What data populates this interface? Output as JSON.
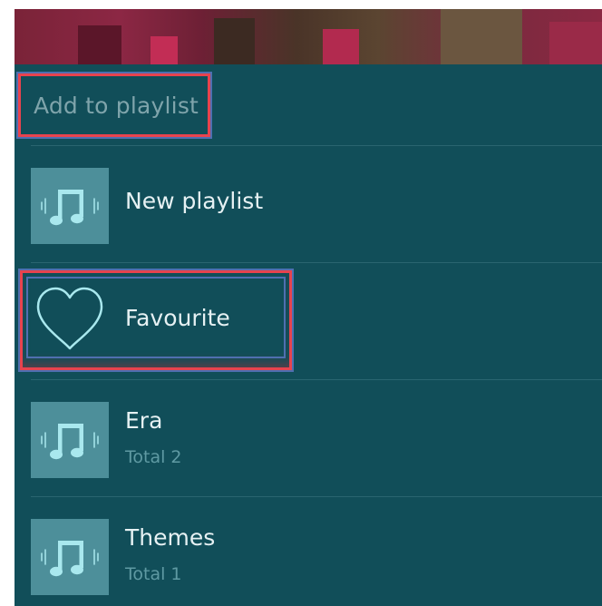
{
  "dialog": {
    "title": "Add to playlist"
  },
  "playlists": [
    {
      "label": "New playlist",
      "subtitle": "",
      "icon": "music-note-icon"
    },
    {
      "label": "Favourite",
      "subtitle": "",
      "icon": "heart-icon"
    },
    {
      "label": "Era",
      "subtitle": "Total 2",
      "icon": "music-note-icon"
    },
    {
      "label": "Themes",
      "subtitle": "Total 1",
      "icon": "music-note-icon"
    }
  ],
  "colors": {
    "background": "#114e59",
    "thumb": "#4d8f9a",
    "highlight_border": "#e8434e",
    "title_text": "#7fa4ab",
    "primary_text": "#e6f1f3",
    "secondary_text": "#5f9aa3"
  }
}
